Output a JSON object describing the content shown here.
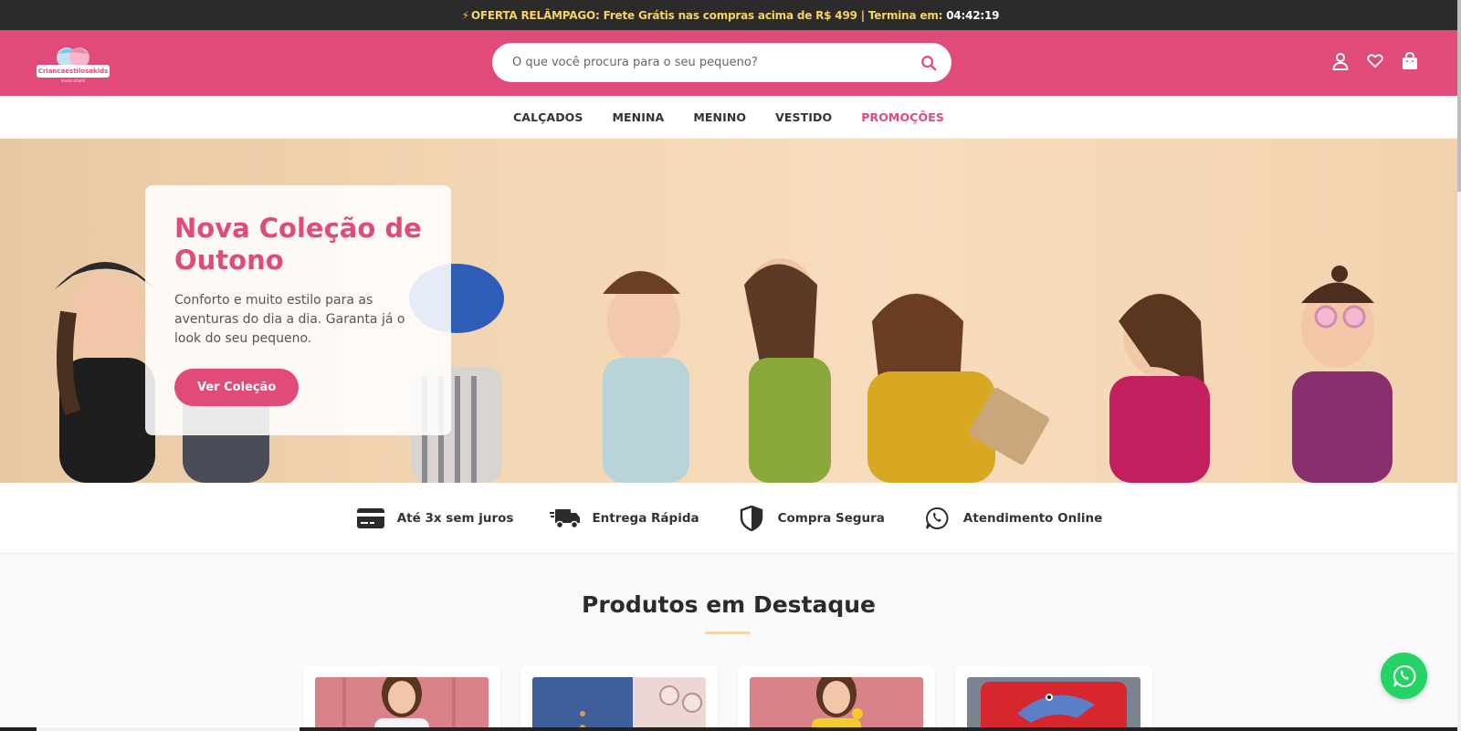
{
  "announcement": {
    "icon": "lightning-icon",
    "text": "OFERTA RELÂMPAGO: Frete Grátis nas compras acima de R$ 499 | Termina em:",
    "timer": "04:42:19"
  },
  "brand": {
    "name": "Criancaestilosakids",
    "tagline": "moda infantil",
    "color": "#e04b7a"
  },
  "search": {
    "placeholder": "O que você procura para o seu pequeno?",
    "value": ""
  },
  "header_icons": [
    "user-icon",
    "heart-icon",
    "bag-icon"
  ],
  "nav": {
    "items": [
      {
        "label": "CALÇADOS"
      },
      {
        "label": "MENINA"
      },
      {
        "label": "MENINO"
      },
      {
        "label": "VESTIDO"
      },
      {
        "label": "PROMOÇÕES",
        "highlight": true
      }
    ]
  },
  "hero": {
    "title": "Nova Coleção de Outono",
    "description": "Conforto e muito estilo para as aventuras do dia a dia. Garanta já o look do seu pequeno.",
    "button": "Ver Coleção"
  },
  "features": [
    {
      "icon": "credit-card-icon",
      "label": "Até 3x sem juros"
    },
    {
      "icon": "truck-icon",
      "label": "Entrega Rápida"
    },
    {
      "icon": "shield-icon",
      "label": "Compra Segura"
    },
    {
      "icon": "whatsapp-icon",
      "label": "Atendimento Online"
    }
  ],
  "featured": {
    "title": "Produtos em Destaque",
    "products": [
      {
        "image": "girl-white-shirt"
      },
      {
        "image": "denim-shorts"
      },
      {
        "image": "girl-yellow-top"
      },
      {
        "image": "shark-shirt"
      }
    ]
  },
  "floating": {
    "icon": "whatsapp-icon",
    "color": "#25d366"
  }
}
